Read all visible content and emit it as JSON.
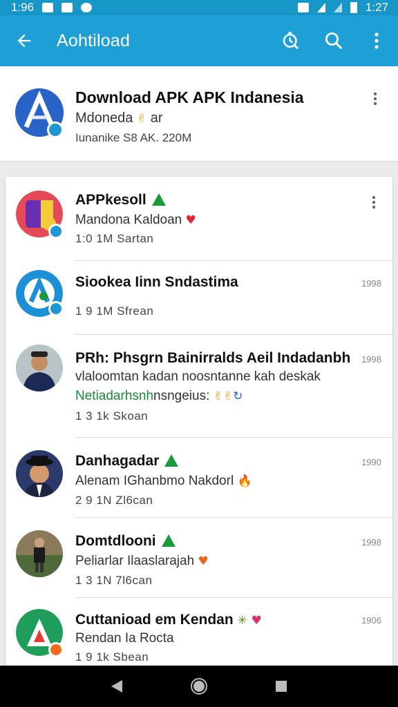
{
  "status_bar": {
    "left_time": "1:96",
    "right_time": "1:27"
  },
  "app_bar": {
    "title": "Aohtiload",
    "icons": [
      "back-arrow-icon",
      "timer-search-icon",
      "search-icon",
      "more-vert-icon"
    ]
  },
  "featured": {
    "title": "Download APK APK Indanesia",
    "subtitle": "Mdoneda",
    "subtitle_emoji": "✌",
    "subtitle_suffix": "ar",
    "meta": "Iunanike S8 AK. 220M"
  },
  "list": [
    {
      "title": "APPkesoll",
      "has_green_badge": true,
      "subtitle": "Mandona Kaldoan",
      "subtitle_emoji": "♥",
      "meta": "1:0 1M  Sartan",
      "time": "",
      "has_more": true
    },
    {
      "title": "Siookea Iinn  Sndastima",
      "subtitle": "",
      "meta": "1 9 1M  Sfrean",
      "time": "1998"
    },
    {
      "title": "PRh: Phsgrn Bainirralds Aeil Indadanbh",
      "subtitle": "vlaloomtan kadan noosntanne kah deskak",
      "green_text": "Netiadarhsnh",
      "green_suffix": "nsngeius:",
      "meta": "1 3  1k  Skoan",
      "time": "1998"
    },
    {
      "title": "Danhagadar",
      "has_green_badge": true,
      "subtitle": "Alenam IGhanbmo Nakdorl",
      "subtitle_emoji": "🔥",
      "meta": "2 9  1N  Zl6can",
      "time": "1990"
    },
    {
      "title": "Domtdlooni",
      "has_green_badge": true,
      "subtitle": "Peliarlar Ilaaslarajah",
      "subtitle_emoji": "♥",
      "meta": "1 3  1N  7l6can",
      "time": "1998"
    },
    {
      "title": "Cuttanioad em Kendan",
      "subtitle": "Rendan Ia Rocta",
      "subtitle_emoji": "♥",
      "meta": "1 9  1k  Sbean",
      "time": "1906"
    }
  ],
  "colors": {
    "app_bar": "#1ea0d6",
    "status_bar": "#1797c8",
    "accent_green": "#1a9a3c"
  }
}
